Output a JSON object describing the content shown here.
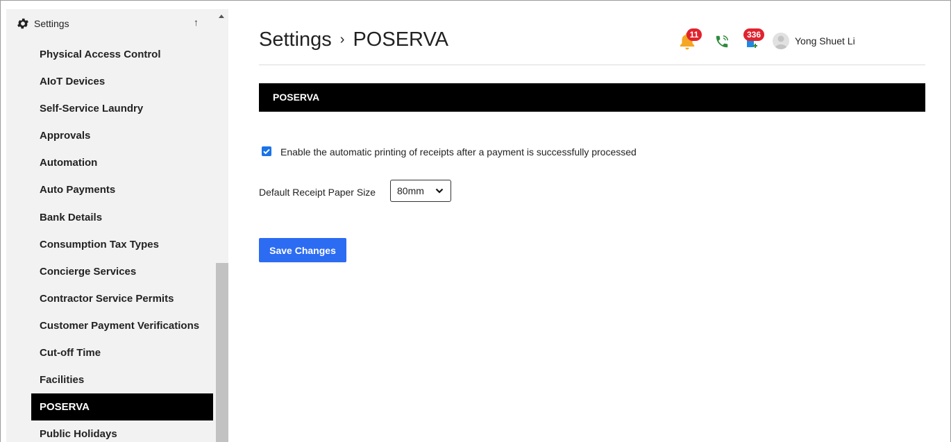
{
  "sidebar": {
    "title": "Settings",
    "collapse_icon": "arrow-up",
    "items": [
      {
        "label": "Physical Access Control",
        "active": false
      },
      {
        "label": "AIoT Devices",
        "active": false
      },
      {
        "label": "Self-Service Laundry",
        "active": false
      },
      {
        "label": "Approvals",
        "active": false
      },
      {
        "label": "Automation",
        "active": false
      },
      {
        "label": "Auto Payments",
        "active": false
      },
      {
        "label": "Bank Details",
        "active": false
      },
      {
        "label": "Consumption Tax Types",
        "active": false
      },
      {
        "label": "Concierge Services",
        "active": false
      },
      {
        "label": "Contractor Service Permits",
        "active": false
      },
      {
        "label": "Customer Payment Verifications",
        "active": false
      },
      {
        "label": "Cut-off Time",
        "active": false
      },
      {
        "label": "Facilities",
        "active": false
      },
      {
        "label": "POSERVA",
        "active": true
      },
      {
        "label": "Public Holidays",
        "active": false
      }
    ]
  },
  "header": {
    "breadcrumb_root": "Settings",
    "breadcrumb_sep": "›",
    "breadcrumb_current": "POSERVA",
    "notifications_count": "11",
    "messages_count": "336",
    "user_name": "Yong Shuet Li"
  },
  "section": {
    "title": "POSERVA",
    "auto_print_label": "Enable the automatic printing of receipts after a payment is successfully processed",
    "auto_print_checked": true,
    "paper_size_label": "Default Receipt Paper Size",
    "paper_size_value": "80mm",
    "save_label": "Save Changes"
  },
  "colors": {
    "accent": "#2c6cf2",
    "badge": "#e0232e",
    "bell": "#f5a623",
    "phone": "#2e8b3d",
    "active_item_bg": "#000000"
  }
}
